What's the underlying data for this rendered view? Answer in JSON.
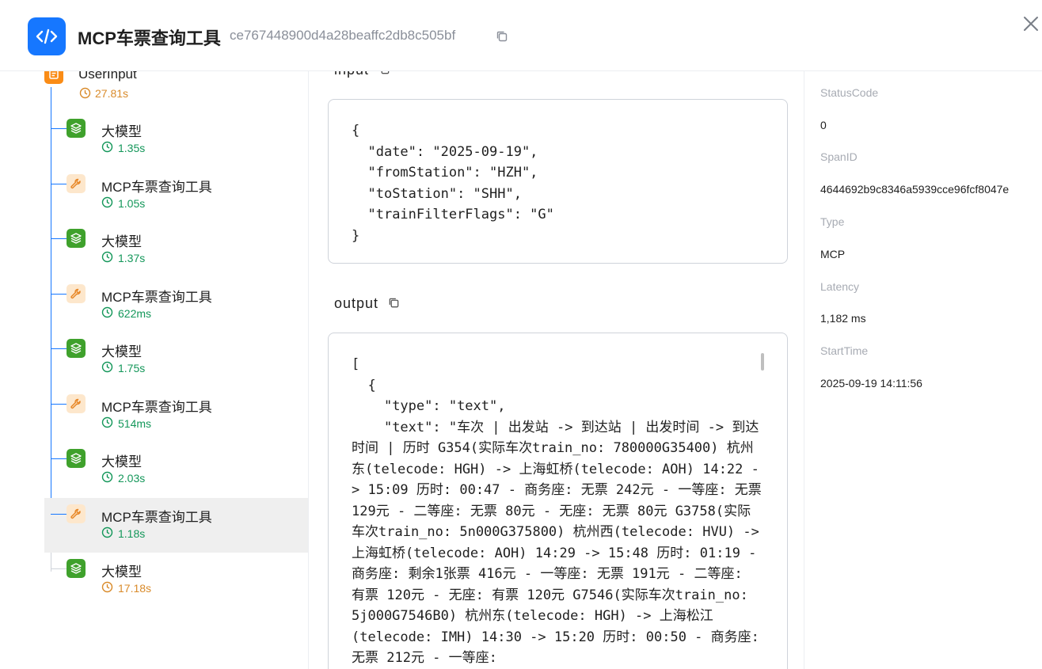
{
  "header": {
    "title": "MCP车票查询工具",
    "trace_id": "ce767448900d4a28beaffc2db8c505bf"
  },
  "tree": {
    "nodes": [
      {
        "name": "UserInput",
        "duration": "27.81s",
        "type": "user",
        "dur_color": "orange"
      },
      {
        "name": "大模型",
        "duration": "1.35s",
        "type": "llm",
        "dur_color": "green"
      },
      {
        "name": "MCP车票查询工具",
        "duration": "1.05s",
        "type": "tool",
        "dur_color": "green"
      },
      {
        "name": "大模型",
        "duration": "1.37s",
        "type": "llm",
        "dur_color": "green"
      },
      {
        "name": "MCP车票查询工具",
        "duration": "622ms",
        "type": "tool",
        "dur_color": "green"
      },
      {
        "name": "大模型",
        "duration": "1.75s",
        "type": "llm",
        "dur_color": "green"
      },
      {
        "name": "MCP车票查询工具",
        "duration": "514ms",
        "type": "tool",
        "dur_color": "green"
      },
      {
        "name": "大模型",
        "duration": "2.03s",
        "type": "llm",
        "dur_color": "green"
      },
      {
        "name": "MCP车票查询工具",
        "duration": "1.18s",
        "type": "tool",
        "dur_color": "green",
        "selected": true
      },
      {
        "name": "大模型",
        "duration": "17.18s",
        "type": "llm",
        "dur_color": "orange"
      }
    ]
  },
  "input": {
    "label": "input",
    "code": "{\n  \"date\": \"2025-09-19\",\n  \"fromStation\": \"HZH\",\n  \"toStation\": \"SHH\",\n  \"trainFilterFlags\": \"G\"\n}"
  },
  "output": {
    "label": "output",
    "code": "[\n  {\n    \"type\": \"text\",\n    \"text\": \"车次 | 出发站 -> 到达站 | 出发时间 -> 到达时间 | 历时 G354(实际车次train_no: 780000G35400) 杭州东(telecode: HGH) -> 上海虹桥(telecode: AOH) 14:22 -> 15:09 历时: 00:47 - 商务座: 无票 242元 - 一等座: 无票 129元 - 二等座: 无票 80元 - 无座: 无票 80元 G3758(实际车次train_no: 5n000G375800) 杭州西(telecode: HVU) -> 上海虹桥(telecode: AOH) 14:29 -> 15:48 历时: 01:19 - 商务座: 剩余1张票 416元 - 一等座: 无票 191元 - 二等座: 有票 120元 - 无座: 有票 120元 G7546(实际车次train_no: 5j000G7546B0) 杭州东(telecode: HGH) -> 上海松江(telecode: IMH) 14:30 -> 15:20 历时: 00:50 - 商务座: 无票 212元 - 一等座:"
  },
  "details": {
    "items": [
      {
        "label": "StatusCode",
        "value": "0"
      },
      {
        "label": "SpanID",
        "value": "4644692b9c8346a5939cce96fcf8047e"
      },
      {
        "label": "Type",
        "value": "MCP"
      },
      {
        "label": "Latency",
        "value": "1,182 ms"
      },
      {
        "label": "StartTime",
        "value": "2025-09-19 14:11:56"
      }
    ]
  },
  "colors": {
    "accent": "#1677ff",
    "llm": "#3fa12c",
    "tool_bg": "#fde7cc",
    "user": "#fa8c16",
    "green_text": "#14975a",
    "orange_text": "#d98b2b"
  }
}
